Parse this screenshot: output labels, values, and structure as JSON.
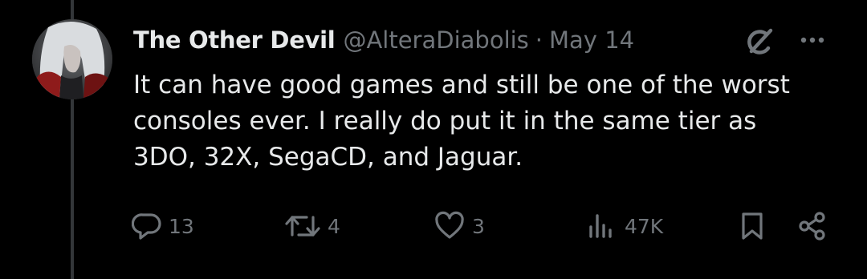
{
  "tweet": {
    "display_name": "The Other Devil",
    "handle": "@AlteraDiabolis",
    "separator": "·",
    "date": "May 14",
    "text": "It can have good games and still be one of the worst\nconsoles ever. I really do put it in the same tier as\n3DO, 32X, SegaCD, and Jaguar."
  },
  "actions": {
    "replies": "13",
    "reposts": "4",
    "likes": "3",
    "views": "47K"
  },
  "icons": {
    "reply": "reply-icon",
    "repost": "repost-icon",
    "like": "heart-icon",
    "views": "views-icon",
    "bookmark": "bookmark-icon",
    "share": "share-icon",
    "grok": "grok-icon",
    "more": "more-icon"
  },
  "colors": {
    "background": "#000000",
    "text": "#e7e9ea",
    "secondary": "#71767b",
    "thread_line": "#333639"
  }
}
